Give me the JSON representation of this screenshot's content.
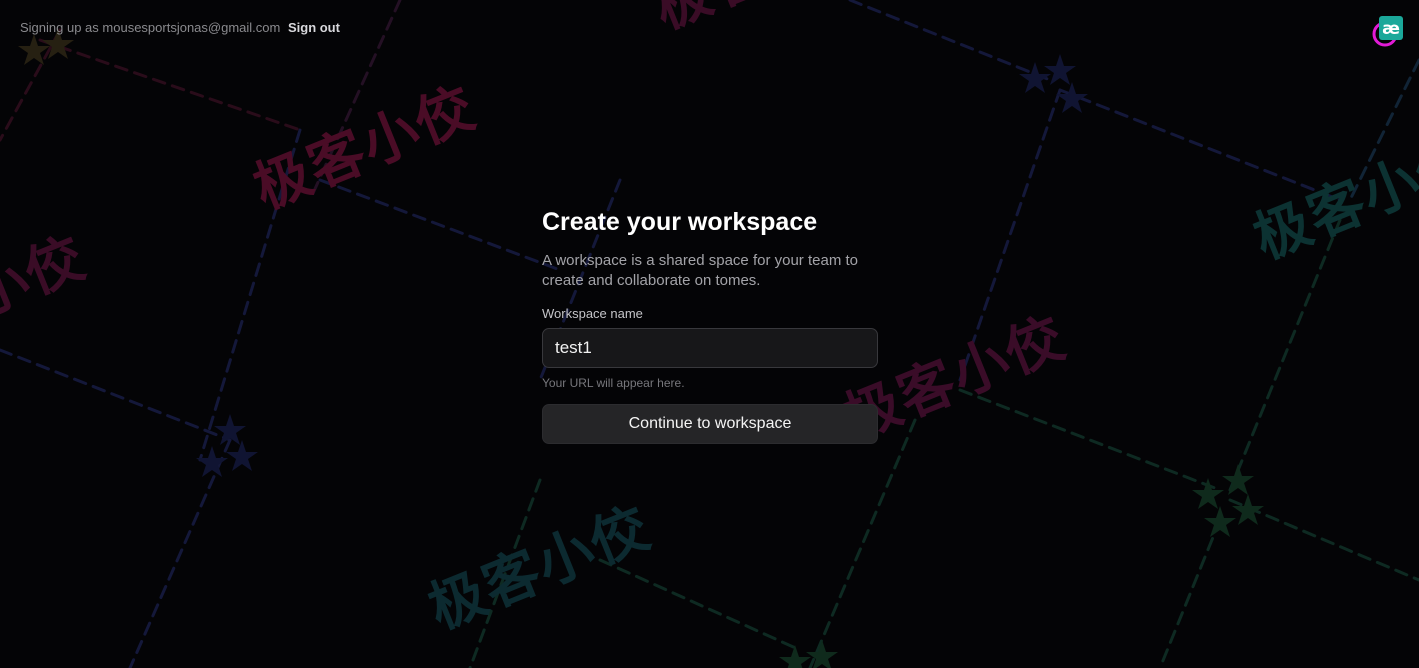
{
  "topbar": {
    "signing_up_prefix": "Signing up as",
    "email": "mousesportsjonas@gmail.com",
    "sign_out": "Sign out"
  },
  "extension_icon": {
    "name": "ae-extension-icon",
    "glyph": "æ"
  },
  "form": {
    "title": "Create your workspace",
    "description": "A workspace is a shared space for your team to create and collaborate on tomes.",
    "field_label": "Workspace name",
    "field_value": "test1",
    "url_hint": "Your URL will appear here.",
    "submit_label": "Continue to workspace"
  },
  "watermark": {
    "text": "极客小佼"
  },
  "colors": {
    "background": "#040406",
    "title": "#ffffff",
    "muted_text": "#a3a3a8",
    "input_bg": "#171719",
    "button_bg": "#252527",
    "watermark_pink": "#5a0f2e",
    "watermark_teal": "#0c3a3a",
    "line_blue": "#14183a",
    "line_green": "#0e2a22",
    "line_pink": "#2a0c1a"
  }
}
